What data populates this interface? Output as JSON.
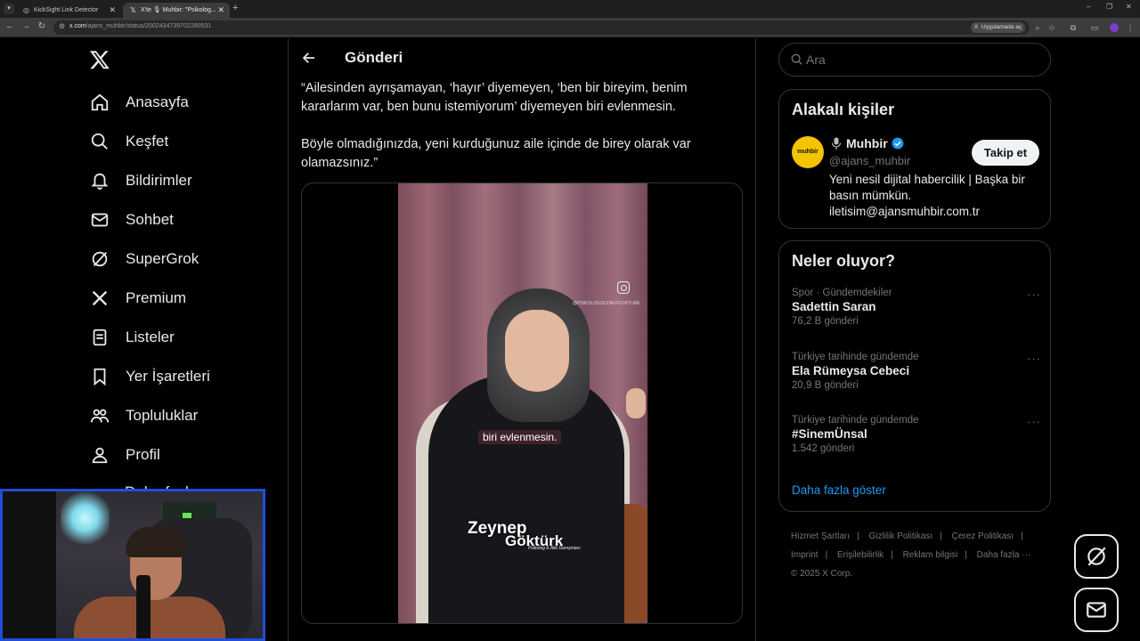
{
  "browser": {
    "tabs": [
      {
        "title": "KickSight Link Detector"
      },
      {
        "title": "X'te 🎙 Muhbir: \"Psikolog..."
      }
    ],
    "url_host": "x.com",
    "url_path": "/ajans_muhbir/status/2002434739702280531",
    "open_in_app": "Uygulamada aç"
  },
  "nav": {
    "items": [
      {
        "label": "Anasayfa",
        "icon": "home-icon"
      },
      {
        "label": "Keşfet",
        "icon": "search-icon"
      },
      {
        "label": "Bildirimler",
        "icon": "bell-icon"
      },
      {
        "label": "Sohbet",
        "icon": "mail-icon"
      },
      {
        "label": "SuperGrok",
        "icon": "grok-icon"
      },
      {
        "label": "Premium",
        "icon": "x-icon"
      },
      {
        "label": "Listeler",
        "icon": "list-icon"
      },
      {
        "label": "Yer İşaretleri",
        "icon": "bookmark-icon"
      },
      {
        "label": "Topluluklar",
        "icon": "community-icon"
      },
      {
        "label": "Profil",
        "icon": "person-icon"
      }
    ],
    "more_label": "Daha fazla"
  },
  "post": {
    "header_title": "Gönderi",
    "paragraphs": [
      "“Ailesinden ayrışamayan, ‘hayır’ diyemeyen, ‘ben bir bireyim, benim kararlarım var, ben bunu istemiyorum’ diyemeyen biri evlenmesin.",
      "Böyle olmadığınızda, yeni kurduğunuz aile içinde de birey olarak var olamazsınız.”"
    ],
    "video": {
      "caption": "biri evlenmesin.",
      "watermark_line1": "Zeynep",
      "watermark_line2": "Göktürk",
      "watermark_sub": "Psikolog & Aile Danışmanı",
      "handle": "@PSIKOLOGZEYNEPGOKTURK"
    }
  },
  "search": {
    "placeholder": "Ara"
  },
  "related": {
    "title": "Alakalı kişiler",
    "name": "Muhbir",
    "handle": "@ajans_muhbir",
    "avatar_text": "muhbir",
    "follow_label": "Takip et",
    "bio": "Yeni nesil dijital habercilik | Başka bir basın mümkün. iletisim@ajansmuhbir.com.tr"
  },
  "trends": {
    "title": "Neler oluyor?",
    "items": [
      {
        "meta": "Spor · Gündemdekiler",
        "topic": "Sadettin Saran",
        "count": "76,2 B gönderi"
      },
      {
        "meta": "Türkiye tarihinde gündemde",
        "topic": "Ela Rümeysa Cebeci",
        "count": "20,9 B gönderi"
      },
      {
        "meta": "Türkiye tarihinde gündemde",
        "topic": "#SinemÜnsal",
        "count": "1.542 gönderi"
      }
    ],
    "show_more": "Daha fazla göster"
  },
  "footer": {
    "links": [
      "Hizmet Şartları",
      "Gizlilik Politikası",
      "Çerez Politikası",
      "Imprint",
      "Erişilebilirlik",
      "Reklam bilgisi",
      "Daha fazla ···"
    ],
    "copyright": "© 2025 X Corp."
  },
  "colors": {
    "accent": "#1d9bf0",
    "background": "#000000",
    "border": "#2f3336"
  }
}
